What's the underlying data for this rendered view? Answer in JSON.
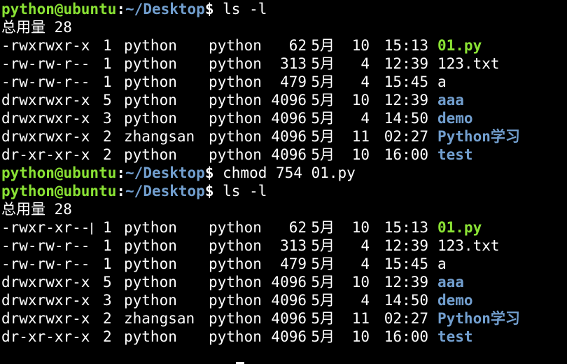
{
  "prompt": {
    "user_host": "python@ubuntu",
    "colon": ":",
    "path": "~/Desktop",
    "dollar": "$"
  },
  "blocks": [
    {
      "command": "ls -l",
      "total": "总用量 28",
      "entries": [
        {
          "perm": "-rwxrwxr-x",
          "links": "1",
          "owner": "python",
          "group": "python",
          "size": "62",
          "month": "5月",
          "day": "10",
          "time": "15:13",
          "name": "01.py",
          "kind": "exec"
        },
        {
          "perm": "-rw-rw-r--",
          "links": "1",
          "owner": "python",
          "group": "python",
          "size": "313",
          "month": "5月",
          "day": "4",
          "time": "12:39",
          "name": "123.txt",
          "kind": "file"
        },
        {
          "perm": "-rw-rw-r--",
          "links": "1",
          "owner": "python",
          "group": "python",
          "size": "479",
          "month": "5月",
          "day": "4",
          "time": "15:45",
          "name": "a",
          "kind": "file"
        },
        {
          "perm": "drwxrwxr-x",
          "links": "5",
          "owner": "python",
          "group": "python",
          "size": "4096",
          "month": "5月",
          "day": "10",
          "time": "12:39",
          "name": "aaa",
          "kind": "dir"
        },
        {
          "perm": "drwxrwxr-x",
          "links": "3",
          "owner": "python",
          "group": "python",
          "size": "4096",
          "month": "5月",
          "day": "4",
          "time": "14:50",
          "name": "demo",
          "kind": "dir"
        },
        {
          "perm": "drwxrwxr-x",
          "links": "2",
          "owner": "zhangsan",
          "group": "python",
          "size": "4096",
          "month": "5月",
          "day": "11",
          "time": "02:27",
          "name": "Python学习",
          "kind": "dir"
        },
        {
          "perm": "dr-xr-xr-x",
          "links": "2",
          "owner": "python",
          "group": "python",
          "size": "4096",
          "month": "5月",
          "day": "10",
          "time": "16:00",
          "name": "test",
          "kind": "dir"
        }
      ]
    },
    {
      "command": "chmod 754 01.py"
    },
    {
      "command": "ls -l",
      "total": "总用量 28",
      "entries": [
        {
          "perm": "-rwxr-xr--",
          "links": "1",
          "owner": "python",
          "group": "python",
          "size": "62",
          "month": "5月",
          "day": "10",
          "time": "15:13",
          "name": "01.py",
          "kind": "exec"
        },
        {
          "perm": "-rw-rw-r--",
          "links": "1",
          "owner": "python",
          "group": "python",
          "size": "313",
          "month": "5月",
          "day": "4",
          "time": "12:39",
          "name": "123.txt",
          "kind": "file"
        },
        {
          "perm": "-rw-rw-r--",
          "links": "1",
          "owner": "python",
          "group": "python",
          "size": "479",
          "month": "5月",
          "day": "4",
          "time": "15:45",
          "name": "a",
          "kind": "file"
        },
        {
          "perm": "drwxrwxr-x",
          "links": "5",
          "owner": "python",
          "group": "python",
          "size": "4096",
          "month": "5月",
          "day": "10",
          "time": "12:39",
          "name": "aaa",
          "kind": "dir"
        },
        {
          "perm": "drwxrwxr-x",
          "links": "3",
          "owner": "python",
          "group": "python",
          "size": "4096",
          "month": "5月",
          "day": "4",
          "time": "14:50",
          "name": "demo",
          "kind": "dir"
        },
        {
          "perm": "drwxrwxr-x",
          "links": "2",
          "owner": "zhangsan",
          "group": "python",
          "size": "4096",
          "month": "5月",
          "day": "11",
          "time": "02:27",
          "name": "Python学习",
          "kind": "dir"
        },
        {
          "perm": "dr-xr-xr-x",
          "links": "2",
          "owner": "python",
          "group": "python",
          "size": "4096",
          "month": "5月",
          "day": "10",
          "time": "16:00",
          "name": "test",
          "kind": "dir"
        }
      ]
    }
  ]
}
